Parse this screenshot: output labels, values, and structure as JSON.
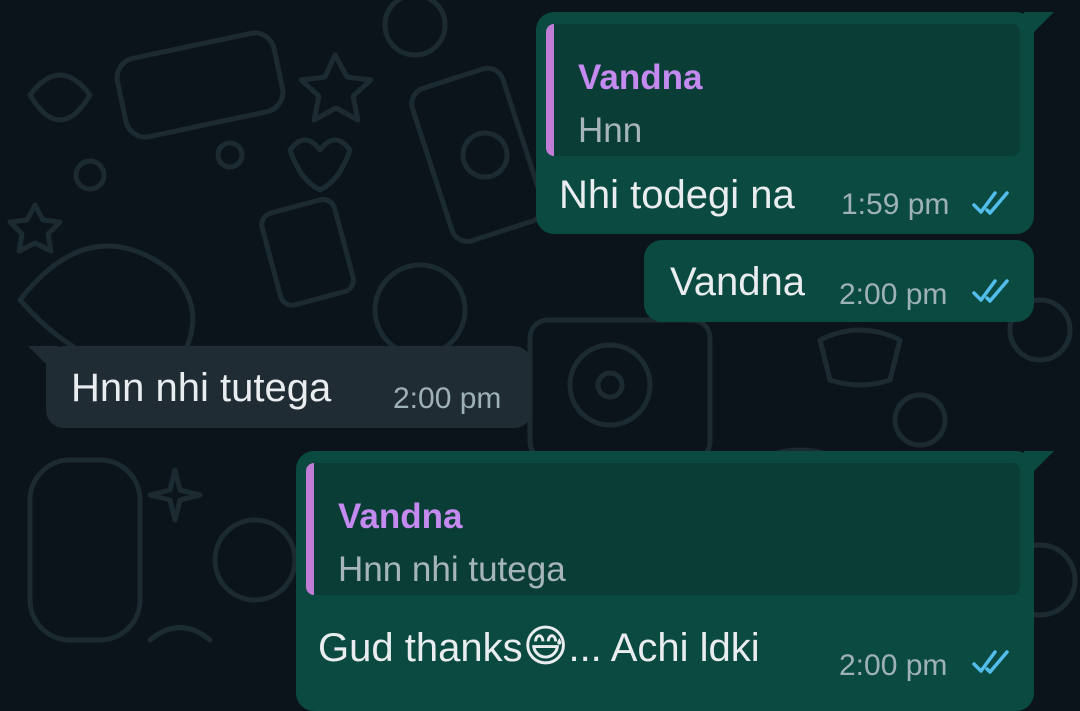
{
  "messages": [
    {
      "direction": "outgoing",
      "reply": {
        "name": "Vandna",
        "text": "Hnn"
      },
      "text": "Nhi todegi na",
      "time": "1:59 pm",
      "status_icon": "double-check-read-icon"
    },
    {
      "direction": "outgoing",
      "text": "Vandna",
      "time": "2:00 pm",
      "status_icon": "double-check-read-icon"
    },
    {
      "direction": "incoming",
      "text": "Hnn nhi tutega",
      "time": "2:00 pm"
    },
    {
      "direction": "outgoing",
      "reply": {
        "name": "Vandna",
        "text": "Hnn nhi tutega"
      },
      "text_before_emoji": "Gud thanks",
      "emoji": "😅",
      "text_after_emoji": "... Achi ldki",
      "time": "2:00 pm",
      "status_icon": "double-check-read-icon"
    }
  ],
  "colors": {
    "background": "#0b141a",
    "outgoing_bubble": "#0b4a40",
    "incoming_bubble": "#202c33",
    "quote_accent": "#c27dd6",
    "read_ticks": "#53bdeb"
  }
}
